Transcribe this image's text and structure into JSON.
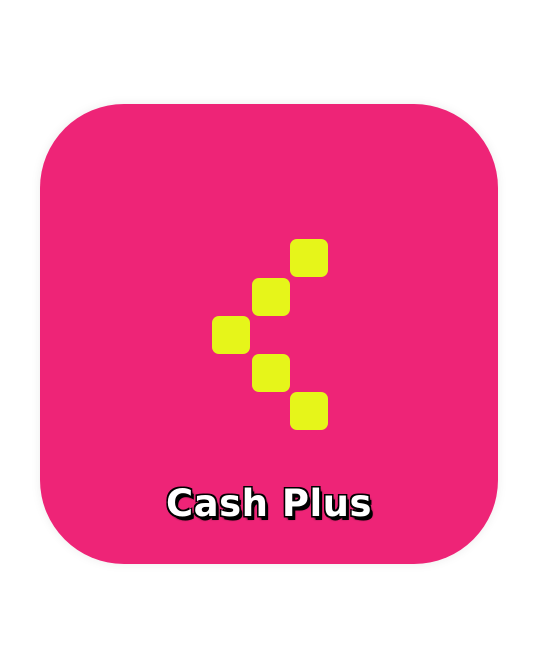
{
  "app": {
    "name": "Cash Plus",
    "icon_background_color": "#ee2477",
    "logo_color": "#e6f51a",
    "logo": "cash-plus-arrow-logo"
  }
}
